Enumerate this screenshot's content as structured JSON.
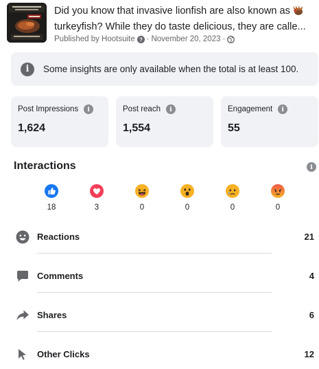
{
  "post": {
    "text_line1": "Did you know that invasive lionfish are also known as",
    "text_line2": "turkeyfish? While they do taste delicious, they are calle...",
    "emoji": "turkey-emoji",
    "publisher": "Published by Hootsuite",
    "date": "November 20, 2023",
    "meta_separator": "·",
    "thumbnail": "lionfish-recipe-thumbnail"
  },
  "notice": {
    "icon": "info-icon",
    "text": "Some insights are only available when the total is at least 100."
  },
  "stats": [
    {
      "label": "Post Impressions",
      "value": "1,624"
    },
    {
      "label": "Post reach",
      "value": "1,554"
    },
    {
      "label": "Engagement",
      "value": "55"
    }
  ],
  "interactions": {
    "title": "Interactions",
    "reactions": [
      {
        "type": "like-icon",
        "count": "18"
      },
      {
        "type": "love-icon",
        "count": "3"
      },
      {
        "type": "haha-icon",
        "count": "0"
      },
      {
        "type": "wow-icon",
        "count": "0"
      },
      {
        "type": "sad-icon",
        "count": "0"
      },
      {
        "type": "angry-icon",
        "count": "0"
      }
    ],
    "metrics": [
      {
        "label": "Reactions",
        "value": "21",
        "icon": "smiley-icon"
      },
      {
        "label": "Comments",
        "value": "4",
        "icon": "comment-bubble-icon"
      },
      {
        "label": "Shares",
        "value": "6",
        "icon": "share-arrow-icon"
      },
      {
        "label": "Other Clicks",
        "value": "12",
        "icon": "cursor-icon"
      }
    ]
  },
  "colors": {
    "like": "#1877f2",
    "love": "#f33e58",
    "emoji_yellow": "#f7b125",
    "angry": "#e9710f",
    "icon_grey": "#65676b",
    "card_bg": "#f0f2f5"
  }
}
